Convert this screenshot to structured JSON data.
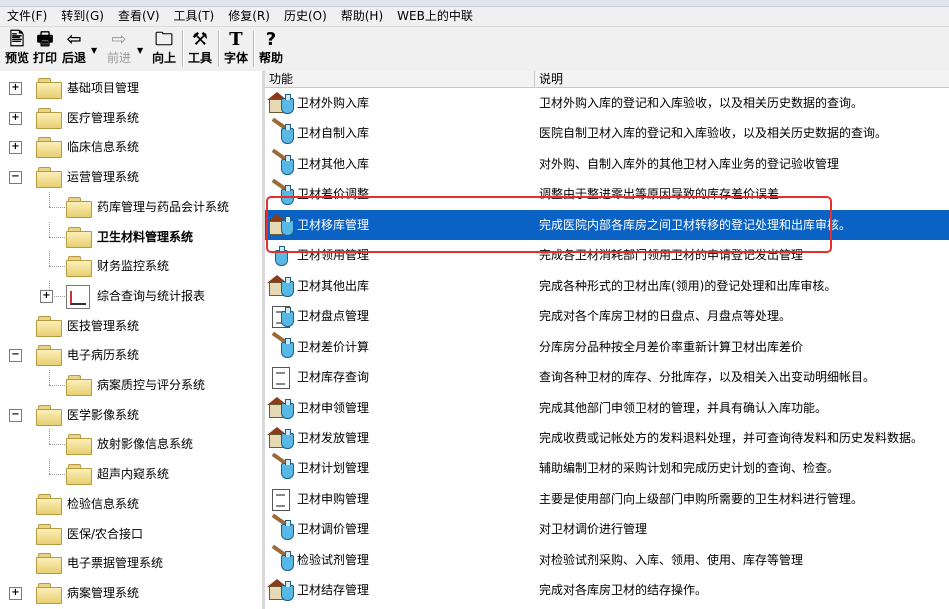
{
  "menubar": [
    "文件(F)",
    "转到(G)",
    "查看(V)",
    "工具(T)",
    "修复(R)",
    "历史(O)",
    "帮助(H)",
    "WEB上的中联"
  ],
  "toolbar": {
    "preview": "预览",
    "print": "打印",
    "back": "后退",
    "forward": "前进",
    "up": "向上",
    "tools": "工具",
    "font": "字体",
    "help": "帮助"
  },
  "tree": [
    {
      "label": "基础项目管理",
      "expander": "+",
      "level": 0
    },
    {
      "label": "医疗管理系统",
      "expander": "+",
      "level": 0
    },
    {
      "label": "临床信息系统",
      "expander": "+",
      "level": 0
    },
    {
      "label": "运营管理系统",
      "expander": "−",
      "level": 0
    },
    {
      "label": "药库管理与药品会计系统",
      "expander": "",
      "level": 1
    },
    {
      "label": "卫生材料管理系统",
      "expander": "",
      "level": 1,
      "bold": true
    },
    {
      "label": "财务监控系统",
      "expander": "",
      "level": 1
    },
    {
      "label": "综合查询与统计报表",
      "expander": "+",
      "level": 1,
      "icon": "report"
    },
    {
      "label": "医技管理系统",
      "expander": "",
      "level": 0
    },
    {
      "label": "电子病历系统",
      "expander": "−",
      "level": 0
    },
    {
      "label": "病案质控与评分系统",
      "expander": "",
      "level": 1
    },
    {
      "label": "医学影像系统",
      "expander": "−",
      "level": 0
    },
    {
      "label": "放射影像信息系统",
      "expander": "",
      "level": 1
    },
    {
      "label": "超声内窥系统",
      "expander": "",
      "level": 1
    },
    {
      "label": "检验信息系统",
      "expander": "",
      "level": 0
    },
    {
      "label": "医保/农合接口",
      "expander": "",
      "level": 0
    },
    {
      "label": "电子票据管理系统",
      "expander": "",
      "level": 0
    },
    {
      "label": "病案管理系统",
      "expander": "+",
      "level": 0
    }
  ],
  "list": {
    "columns": [
      "功能",
      "说明"
    ],
    "rows": [
      {
        "name": "卫材外购入库",
        "desc": "卫材外购入库的登记和入库验收，以及相关历史数据的查询。",
        "icon": "house-flask"
      },
      {
        "name": "卫材自制入库",
        "desc": "医院自制卫材入库的登记和入库验收，以及相关历史数据的查询。",
        "icon": "tool-flask"
      },
      {
        "name": "卫材其他入库",
        "desc": "对外购、自制入库外的其他卫材入库业务的登记验收管理",
        "icon": "tool-flask"
      },
      {
        "name": "卫材差价调整",
        "desc": "调整由于整进零出等原因导致的库存差价误差",
        "icon": "tool-flask"
      },
      {
        "name": "卫材移库管理",
        "desc": "完成医院内部各库房之间卫材转移的登记处理和出库审核。",
        "icon": "house-flask",
        "selected": true
      },
      {
        "name": "卫材领用管理",
        "desc": "完成各卫材消耗部门领用卫材的申请登记发出管理",
        "icon": "flask"
      },
      {
        "name": "卫材其他出库",
        "desc": "完成各种形式的卫材出库(领用)的登记处理和出库审核。",
        "icon": "house-flask"
      },
      {
        "name": "卫材盘点管理",
        "desc": "完成对各个库房卫材的日盘点、月盘点等处理。",
        "icon": "doc-flask"
      },
      {
        "name": "卫材差价计算",
        "desc": "分库房分品种按全月差价率重新计算卫材出库差价",
        "icon": "tool-flask"
      },
      {
        "name": "卫材库存查询",
        "desc": "查询各种卫材的库存、分批库存，以及相关入出变动明细帐目。",
        "icon": "doc"
      },
      {
        "name": "卫材申领管理",
        "desc": "完成其他部门申领卫材的管理，并具有确认入库功能。",
        "icon": "house-flask"
      },
      {
        "name": "卫材发放管理",
        "desc": "完成收费或记帐处方的发料退料处理，并可查询待发料和历史发料数据。",
        "icon": "house-flask"
      },
      {
        "name": "卫材计划管理",
        "desc": "辅助编制卫材的采购计划和完成历史计划的查询、检查。",
        "icon": "tool-flask"
      },
      {
        "name": "卫材申购管理",
        "desc": "主要是使用部门向上级部门申购所需要的卫生材料进行管理。",
        "icon": "doc"
      },
      {
        "name": "卫材调价管理",
        "desc": "对卫材调价进行管理",
        "icon": "tool-flask"
      },
      {
        "name": "检验试剂管理",
        "desc": "对检验试剂采购、入库、领用、使用、库存等管理",
        "icon": "tool-flask"
      },
      {
        "name": "卫材结存管理",
        "desc": "完成对各库房卫材的结存操作。",
        "icon": "house-flask"
      }
    ]
  },
  "colors": {
    "selection": "#0a62c4",
    "highlight_box": "#e5302a"
  }
}
